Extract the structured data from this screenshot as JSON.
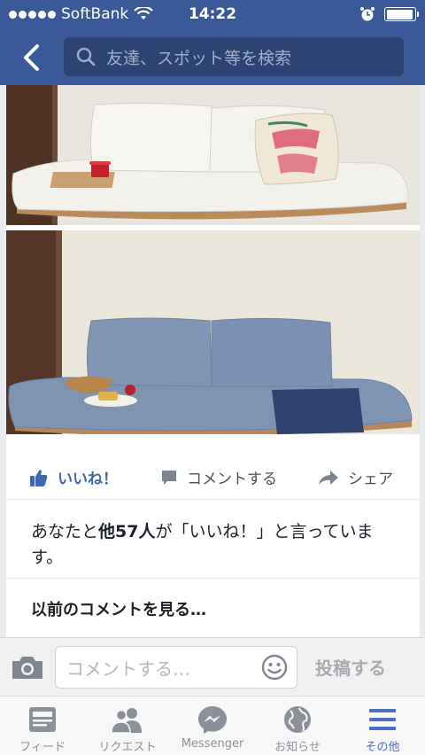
{
  "status_bar": {
    "carrier": "SoftBank",
    "time": "14:22",
    "battery_level": 0.95
  },
  "search": {
    "placeholder": "友達、スポット等を検索"
  },
  "post": {
    "actions": {
      "like": "いいね！",
      "comment": "コメントする",
      "share": "シェア"
    },
    "likes_prefix": "あなたと",
    "likes_bold": "他57人",
    "likes_suffix": "が「いいね！」と言っています。",
    "previous_comments": "以前のコメントを見る…"
  },
  "composer": {
    "placeholder": "コメントする…",
    "post_label": "投稿する"
  },
  "tabs": [
    {
      "label": "フィード",
      "icon": "feed-icon"
    },
    {
      "label": "リクエスト",
      "icon": "friend-requests-icon"
    },
    {
      "label": "Messenger",
      "icon": "messenger-icon"
    },
    {
      "label": "お知らせ",
      "icon": "globe-icon"
    },
    {
      "label": "その他",
      "icon": "menu-icon",
      "active": true
    }
  ],
  "colors": {
    "brand": "#3b5998",
    "search_bg": "#2d4373",
    "active_tab": "#4a6fc4"
  }
}
